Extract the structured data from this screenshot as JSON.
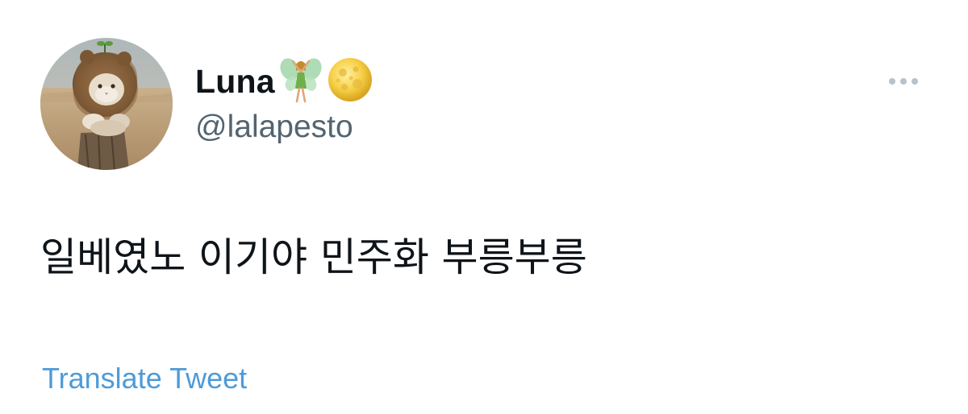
{
  "user": {
    "display_name": "Luna",
    "handle": "@lalapesto",
    "name_emojis": [
      "fairy-icon",
      "full-moon-icon"
    ]
  },
  "tweet": {
    "text": "일베였노 이기야 민주화 부릉부릉"
  },
  "actions": {
    "translate_label": "Translate Tweet",
    "more_icon": "more-horizontal-icon"
  },
  "colors": {
    "text": "#0f1419",
    "secondary_text": "#536471",
    "link": "#4d9bd9",
    "background": "#ffffff"
  }
}
